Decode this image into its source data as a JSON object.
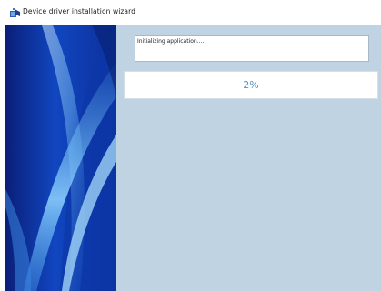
{
  "window": {
    "title": "Device driver installation wizard",
    "icon": "installer-app-icon"
  },
  "status": {
    "message": "Initializing application...."
  },
  "progress": {
    "percent_label": "2%",
    "value": 0.02
  },
  "colors": {
    "panel_background": "#bfd3e2",
    "progress_text": "#5a93c3",
    "side_art_dark": "#0b2a8c",
    "side_art_light": "#7ec8f5"
  }
}
